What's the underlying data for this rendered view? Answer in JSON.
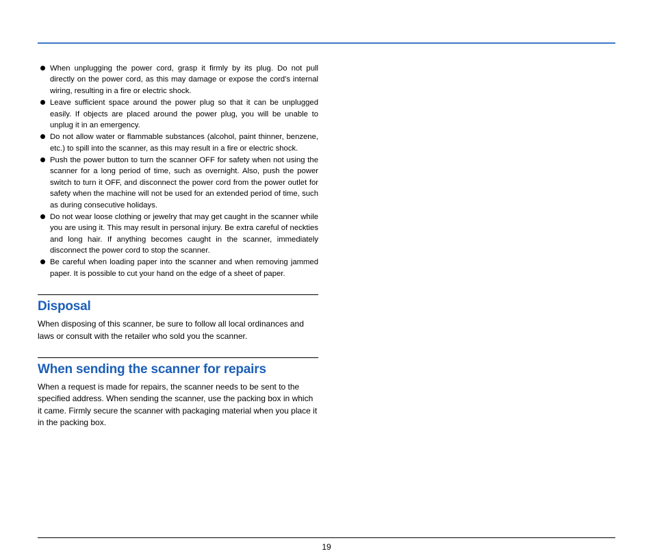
{
  "bullets": [
    "When unplugging the power cord, grasp it firmly by its plug. Do not pull directly on the power cord, as this may damage or expose the cord's internal wiring, resulting in a fire or electric shock.",
    "Leave sufficient space around the power plug so that it can be unplugged easily. If objects are placed around the power plug, you will be unable to unplug it in an emergency.",
    "Do not allow water or flammable substances (alcohol, paint thinner, benzene, etc.) to spill into the scanner, as this may result in a fire or electric shock.",
    "Push the power button to turn the scanner OFF for safety when not using the scanner for a long period of time, such as overnight. Also, push the power switch to turn it OFF, and disconnect the power cord from the power outlet for safety when the machine will not be used for an extended period of time, such as during consecutive holidays.",
    "Do not wear loose clothing or jewelry that may get caught in the scanner while you are using it. This may result in personal injury. Be extra careful of neckties and long hair. If anything becomes caught in the scanner, immediately disconnect the power cord to stop the scanner.",
    "Be careful when loading paper into the scanner and when removing jammed paper. It is possible to cut your hand on the edge of a sheet of paper."
  ],
  "sections": {
    "disposal": {
      "heading": "Disposal",
      "body": "When disposing of this scanner, be sure to follow all local ordinances and laws or consult with the retailer who sold you the scanner."
    },
    "repairs": {
      "heading": "When sending the scanner for repairs",
      "body": "When a request is made for repairs, the scanner needs to be sent to the specified address. When sending the scanner, use the packing box in which it came. Firmly secure the scanner with packaging material when you place it in the packing box."
    }
  },
  "pageNumber": "19"
}
